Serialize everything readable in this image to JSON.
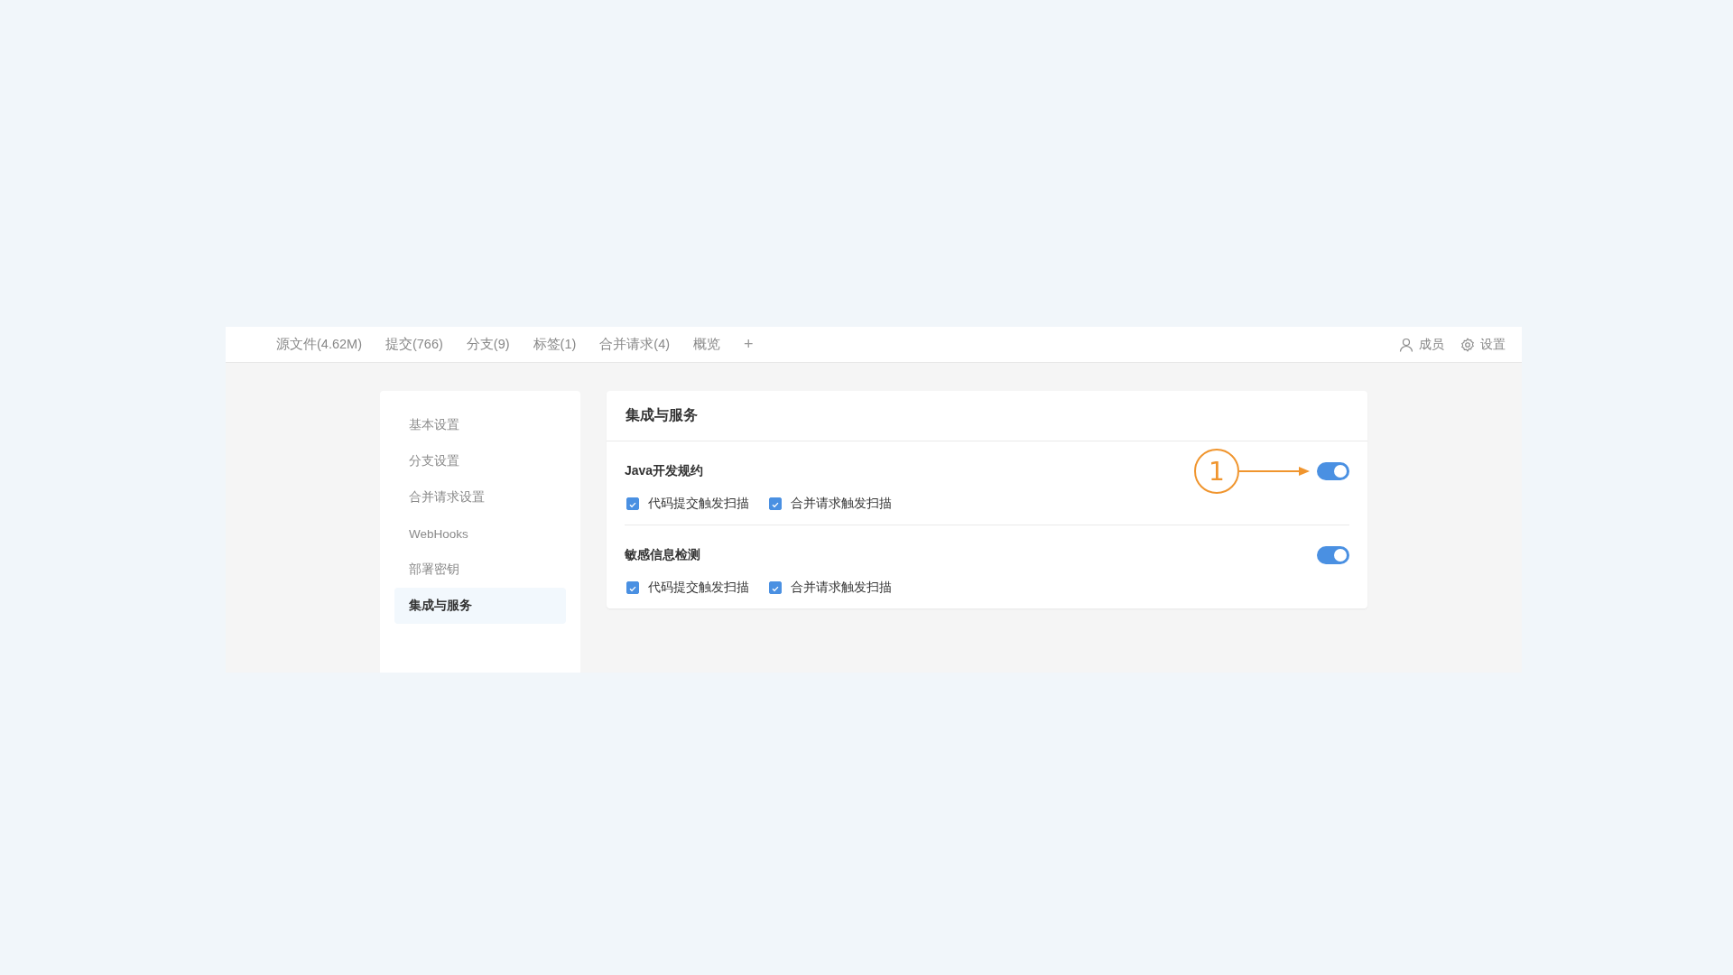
{
  "nav": {
    "tabs": [
      {
        "label": "源文件(4.62M)",
        "selected": false
      },
      {
        "label": "提交(766)",
        "selected": false
      },
      {
        "label": "分支(9)",
        "selected": false
      },
      {
        "label": "标签(1)",
        "selected": false
      },
      {
        "label": "合并请求(4)",
        "selected": false
      },
      {
        "label": "概览",
        "selected": false
      }
    ],
    "add": "+",
    "actions": [
      {
        "kind": "members",
        "label": "成员"
      },
      {
        "kind": "settings",
        "label": "设置"
      }
    ]
  },
  "sidebar": {
    "items": [
      {
        "label": "基本设置",
        "selected": false
      },
      {
        "label": "分支设置",
        "selected": false
      },
      {
        "label": "合并请求设置",
        "selected": false
      },
      {
        "label": "WebHooks",
        "selected": false
      },
      {
        "label": "部署密钥",
        "selected": false
      },
      {
        "label": "集成与服务",
        "selected": true
      }
    ]
  },
  "panel": {
    "title": "集成与服务",
    "services": [
      {
        "name": "Java开发规约",
        "on": true,
        "callout": "1",
        "options": [
          {
            "label": "代码提交触发扫描",
            "checked": true
          },
          {
            "label": "合并请求触发扫描",
            "checked": true
          }
        ]
      },
      {
        "name": "敏感信息检测",
        "on": true,
        "options": [
          {
            "label": "代码提交触发扫描",
            "checked": true
          },
          {
            "label": "合并请求触发扫描",
            "checked": true
          }
        ]
      }
    ]
  }
}
